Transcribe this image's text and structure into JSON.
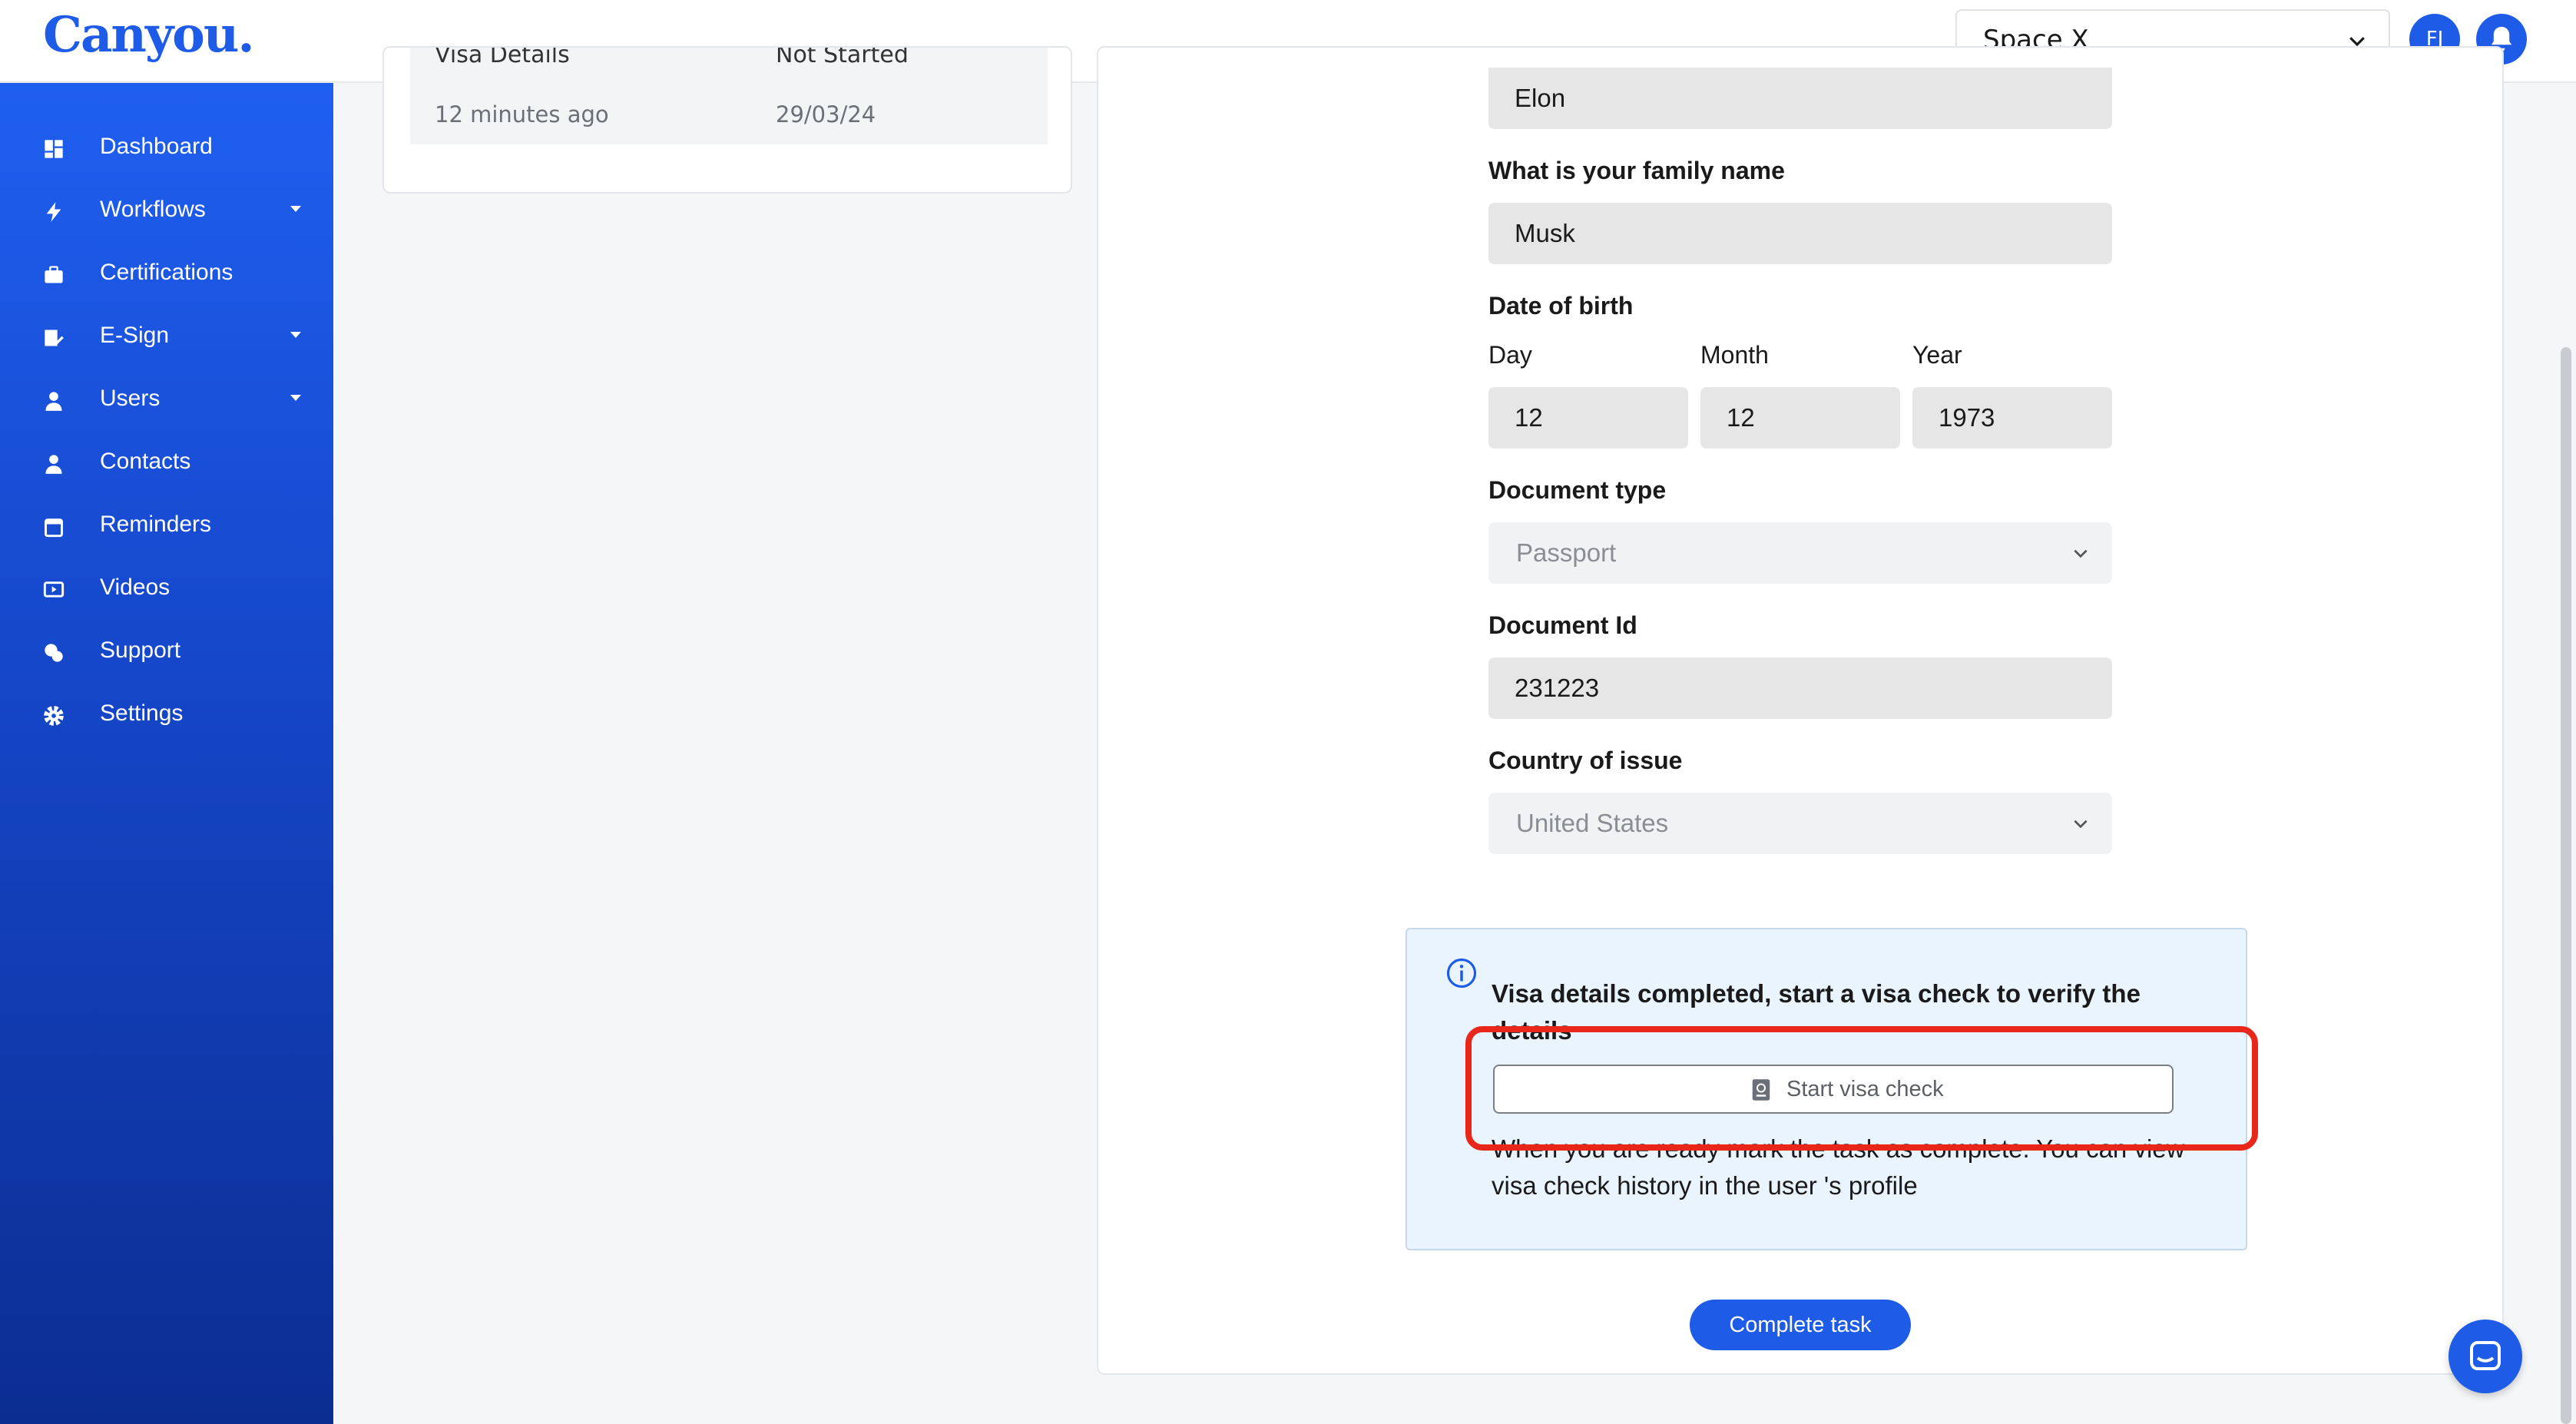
{
  "app": {
    "logo": "Canyou."
  },
  "header": {
    "workspace": "Space X",
    "avatar_initials": "FJ"
  },
  "sidebar": {
    "items": [
      {
        "label": "Dashboard",
        "icon": "dashboard-icon",
        "has_caret": false
      },
      {
        "label": "Workflows",
        "icon": "lightning-icon",
        "has_caret": true
      },
      {
        "label": "Certifications",
        "icon": "briefcase-icon",
        "has_caret": false
      },
      {
        "label": "E-Sign",
        "icon": "pen-document-icon",
        "has_caret": true
      },
      {
        "label": "Users",
        "icon": "user-icon",
        "has_caret": true
      },
      {
        "label": "Contacts",
        "icon": "user-icon",
        "has_caret": false
      },
      {
        "label": "Reminders",
        "icon": "calendar-icon",
        "has_caret": false
      },
      {
        "label": "Videos",
        "icon": "video-icon",
        "has_caret": false
      },
      {
        "label": "Support",
        "icon": "chat-icon",
        "has_caret": false
      },
      {
        "label": "Settings",
        "icon": "gear-icon",
        "has_caret": false
      }
    ]
  },
  "task_list": {
    "row": {
      "name": "Visa Details",
      "status": "Not Started",
      "updated": "12 minutes ago",
      "date": "29/03/24"
    }
  },
  "form": {
    "given_name_value": "Elon",
    "family_name_label": "What is your family name",
    "family_name_value": "Musk",
    "dob_label": "Date of birth",
    "day_label": "Day",
    "month_label": "Month",
    "year_label": "Year",
    "day_value": "12",
    "month_value": "12",
    "year_value": "1973",
    "doc_type_label": "Document type",
    "doc_type_value": "Passport",
    "doc_id_label": "Document Id",
    "doc_id_value": "231223",
    "country_label": "Country of issue",
    "country_value": "United States"
  },
  "info": {
    "message": "Visa details completed, start a visa check to verify the details",
    "button_label": "Start visa check",
    "footer": "When you are ready mark the task as complete. You can view visa check history in the user 's profile"
  },
  "actions": {
    "complete_label": "Complete task"
  },
  "colors": {
    "brand": "#1e5ce8",
    "highlight": "#e8271a"
  }
}
